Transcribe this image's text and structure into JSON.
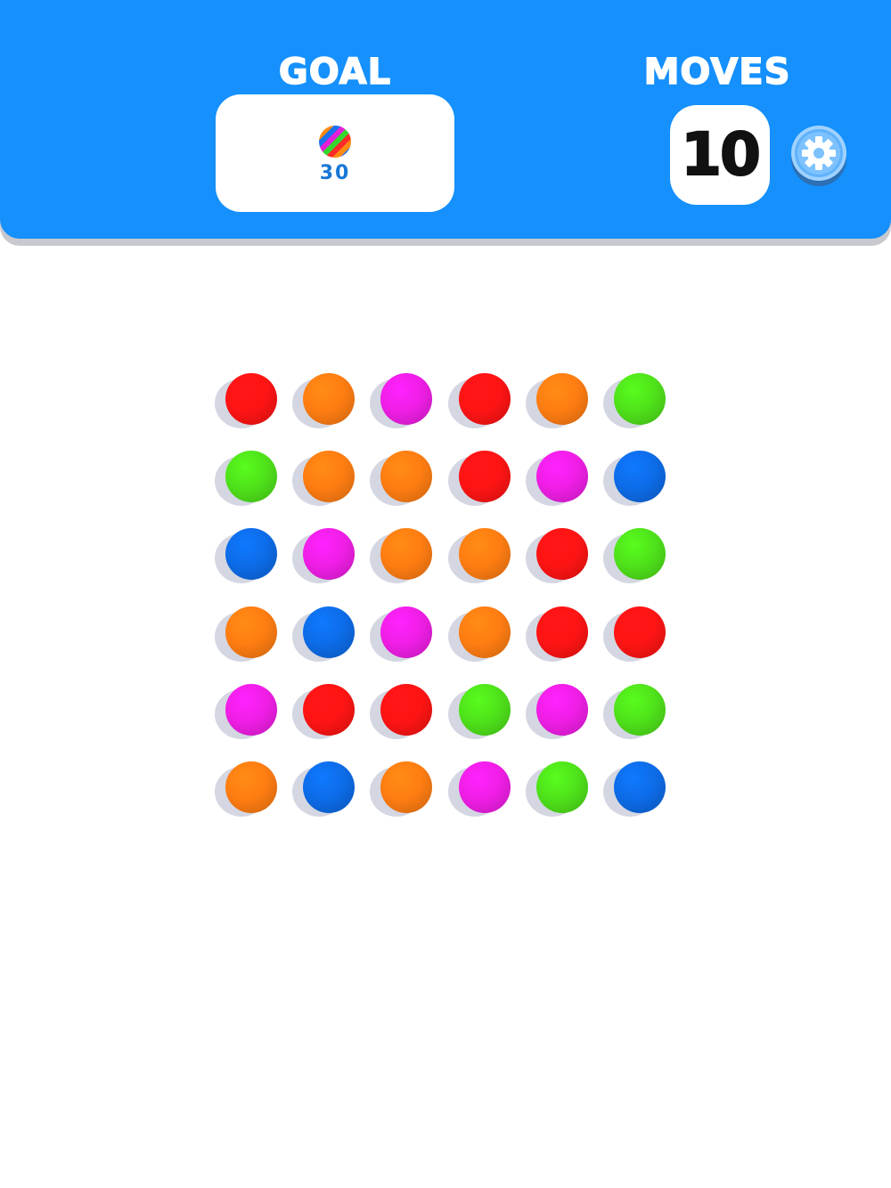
{
  "header": {
    "goal_label": "GOAL",
    "goal_count": "30",
    "moves_label": "MOVES",
    "moves_count": "10",
    "settings_icon": "gear-icon",
    "goal_icon": "striped-multicolor-ball-icon"
  },
  "colors": {
    "header_bg": "#1590fc",
    "red": "#ff1414",
    "orange": "#ff7d12",
    "magenta": "#f01ee6",
    "green": "#4fe21a",
    "blue": "#0d6ce8"
  },
  "board": {
    "rows": 6,
    "cols": 6,
    "grid": [
      [
        "red",
        "orange",
        "magenta",
        "red",
        "orange",
        "green"
      ],
      [
        "green",
        "orange",
        "orange",
        "red",
        "magenta",
        "blue"
      ],
      [
        "blue",
        "magenta",
        "orange",
        "orange",
        "red",
        "green"
      ],
      [
        "orange",
        "blue",
        "magenta",
        "orange",
        "red",
        "red"
      ],
      [
        "magenta",
        "red",
        "red",
        "green",
        "magenta",
        "green"
      ],
      [
        "orange",
        "blue",
        "orange",
        "magenta",
        "green",
        "blue"
      ]
    ]
  }
}
